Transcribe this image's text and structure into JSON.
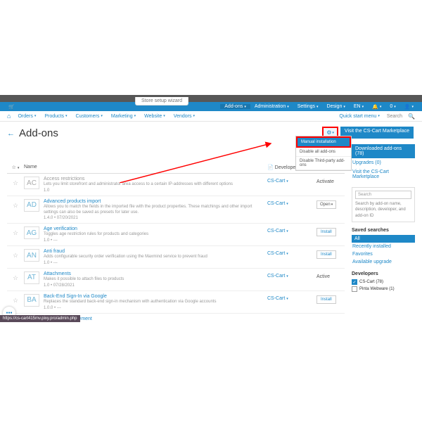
{
  "wizard": "Store setup wizard",
  "bluebar": {
    "addons": "Add-ons",
    "admin": "Administration",
    "settings": "Settings",
    "design": "Design",
    "lang": "EN",
    "cart": "0"
  },
  "nav": {
    "orders": "Orders",
    "products": "Products",
    "customers": "Customers",
    "marketing": "Marketing",
    "website": "Website",
    "vendors": "Vendors",
    "quick": "Quick start menu",
    "search": "Search"
  },
  "page": {
    "title": "Add-ons",
    "back": "←"
  },
  "gear": "⚙",
  "visit": "Visit the CS-Cart Marketplace",
  "dropdown": {
    "manual": "Manual installation",
    "disable_all": "Disable all add-ons",
    "disable_third": "Disable Third-party add-ons"
  },
  "thead": {
    "star": "☆",
    "name": "Name",
    "dev": "Developer"
  },
  "rows": [
    {
      "badge": "AC",
      "gray": true,
      "name": "Access restrictions",
      "desc": "Lets you limit storefront and administrator area access to a certain IP-addresses with different options",
      "ver": "1.0",
      "dev": "CS-Cart",
      "action": "activate",
      "act_label": "Activate"
    },
    {
      "badge": "AD",
      "name": "Advanced products import",
      "desc": "Allows you to match the fields in the imported file with the product properties. These matchings and other import settings can also be saved as presets for later use.",
      "ver": "1.4.0 • 07/20/2021",
      "dev": "CS-Cart",
      "action": "open",
      "act_label": "Open"
    },
    {
      "badge": "AG",
      "name": "Age verification",
      "desc": "Toggles age restriction rules for products and categories",
      "ver": "1.0 • ---",
      "dev": "CS-Cart",
      "action": "install",
      "act_label": "Install"
    },
    {
      "badge": "AN",
      "name": "Anti fraud",
      "desc": "Adds configurable security order verification using the Maxmind service to prevent fraud",
      "ver": "1.0 • ---",
      "dev": "CS-Cart",
      "action": "install",
      "act_label": "Install"
    },
    {
      "badge": "AT",
      "name": "Attachments",
      "desc": "Makes it possible to attach files to products",
      "ver": "1.0 • 07/28/2021",
      "dev": "CS-Cart",
      "action": "active",
      "act_label": "Active"
    },
    {
      "badge": "BA",
      "name": "Back-End Sign-In via Google",
      "desc": "Replaces the standard back-end sign-in mechanism with authentication via Google accounts",
      "ver": "1.0.0 • ---",
      "dev": "CS-Cart",
      "action": "install",
      "act_label": "Install"
    }
  ],
  "last_link": "Banners management",
  "side": {
    "tab": "Downloaded add-ons (78)",
    "upgrades": "Upgrades (0)",
    "visit": "Visit the CS-Cart Marketplace",
    "search_ph": "Search",
    "search_txt": "Search by add-on name, description, developer, and add-on ID",
    "saved_head": "Saved searches",
    "saved": {
      "all": "All",
      "recent": "Recently installed",
      "fav": "Favorites",
      "avail": "Available upgrade"
    },
    "dev_head": "Developers",
    "devs": [
      {
        "name": "CS-Cart (78)",
        "on": true
      },
      {
        "name": "Pinta Webware (1)",
        "on": false
      }
    ]
  },
  "url": "https://cs-cart415mv.pixy.pro/admin.php"
}
